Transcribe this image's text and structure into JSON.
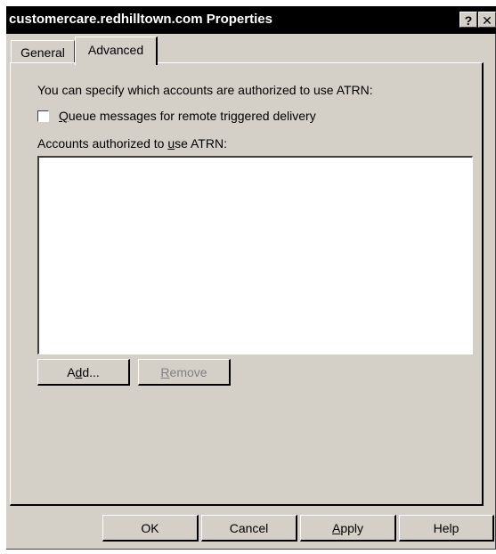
{
  "window": {
    "title": "customercare.redhilltown.com Properties",
    "help_glyph": "?",
    "close_glyph": "✕"
  },
  "tabs": [
    {
      "label": "General",
      "selected": false
    },
    {
      "label": "Advanced",
      "selected": true
    }
  ],
  "advanced": {
    "intro_text": "You can specify which accounts are authorized to use ATRN:",
    "queue_checkbox": {
      "label_pre": "",
      "label_accel": "Q",
      "label_post": "ueue messages for remote triggered delivery",
      "checked": false
    },
    "accounts_label": {
      "pre": "Accounts authorized to ",
      "accel": "u",
      "post": "se ATRN:"
    },
    "accounts_list": [],
    "add_button": {
      "pre": "A",
      "accel": "d",
      "post": "d..."
    },
    "remove_button": {
      "pre": "",
      "accel": "R",
      "post": "emove",
      "enabled": false
    }
  },
  "footer": {
    "ok": "OK",
    "cancel": "Cancel",
    "apply": {
      "pre": "",
      "accel": "A",
      "post": "pply"
    },
    "help": "Help"
  }
}
